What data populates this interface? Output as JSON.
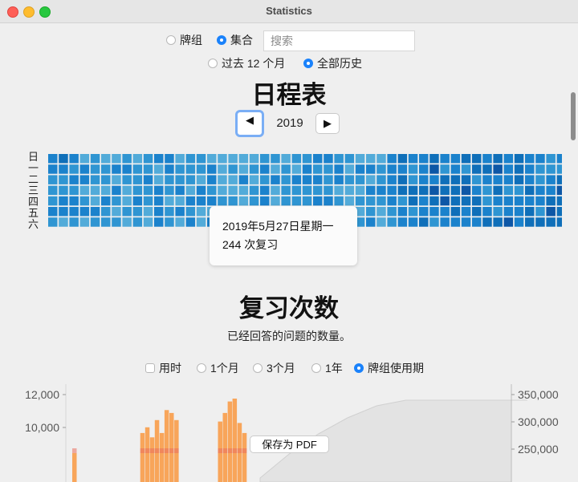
{
  "window": {
    "title": "Statistics"
  },
  "scope": {
    "deck": "牌组",
    "collection": "集合",
    "selected": "collection",
    "search_placeholder": "搜索"
  },
  "period": {
    "last12": "过去 12 个月",
    "all": "全部历史",
    "selected": "all"
  },
  "calendar": {
    "title": "日程表",
    "year": "2019",
    "prev_icon": "◀",
    "next_icon": "▶",
    "day_labels": [
      "日",
      "一",
      "二",
      "三",
      "四",
      "五",
      "六"
    ],
    "tooltip": {
      "date": "2019年5月27日星期一",
      "reviews": "244 次复习"
    }
  },
  "reviews": {
    "title": "复习次数",
    "subtitle": "已经回答的问题的数量。",
    "time_label": "用时",
    "ranges": [
      "1个月",
      "3个月",
      "1年",
      "牌组使用期"
    ],
    "selected_range": "牌组使用期"
  },
  "chart_data": {
    "type": "bar",
    "left_axis_ticks": [
      "12,000",
      "10,000"
    ],
    "right_axis_ticks": [
      "350,000",
      "300,000",
      "250,000"
    ],
    "left_ticks_values": [
      12000,
      10000
    ],
    "right_ticks_values": [
      350000,
      300000,
      250000
    ],
    "y_left_visible_range": [
      9000,
      12000
    ],
    "y_right_visible_range": [
      245000,
      350000
    ],
    "bars": [
      {
        "index": 0,
        "value": 9200
      },
      {
        "index": 14,
        "value": 9900
      },
      {
        "index": 15,
        "value": 10100
      },
      {
        "index": 16,
        "value": 9750
      },
      {
        "index": 17,
        "value": 10350
      },
      {
        "index": 18,
        "value": 9900
      },
      {
        "index": 19,
        "value": 10700
      },
      {
        "index": 20,
        "value": 10600
      },
      {
        "index": 21,
        "value": 10350
      },
      {
        "index": 30,
        "value": 10300
      },
      {
        "index": 31,
        "value": 10600
      },
      {
        "index": 32,
        "value": 11000
      },
      {
        "index": 33,
        "value": 11100
      },
      {
        "index": 34,
        "value": 10250
      },
      {
        "index": 35,
        "value": 9900
      }
    ],
    "cumulative": [
      {
        "index": 40,
        "value": 245000
      },
      {
        "index": 46,
        "value": 275000
      },
      {
        "index": 52,
        "value": 300000
      },
      {
        "index": 58,
        "value": 320000
      },
      {
        "index": 64,
        "value": 335000
      },
      {
        "index": 70,
        "value": 342000
      },
      {
        "index": 80,
        "value": 342000
      },
      {
        "index": 95,
        "value": 342000
      }
    ],
    "grid": false
  },
  "footer": {
    "save_pdf": "保存为 PDF"
  },
  "colors": {
    "accent": "#1a82fb",
    "bar": "#f8a55a",
    "cumulative_fill": "#e2e2e2",
    "heat_dark": "#0d57a6",
    "heat_mid": "#1b82cc",
    "heat_light": "#52abd9"
  }
}
